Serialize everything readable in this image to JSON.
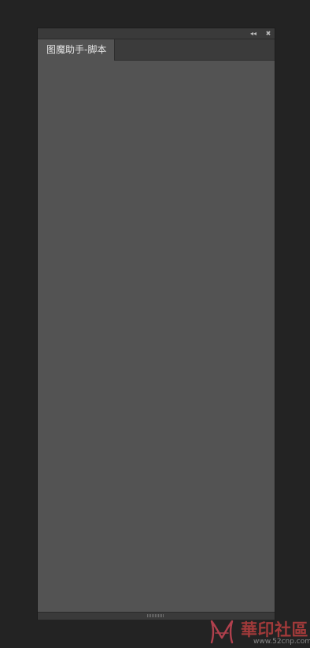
{
  "panel": {
    "collapse_icon": "double-chevron-left",
    "close_icon": "close-x",
    "tabs": [
      {
        "label": "图魔助手-脚本",
        "active": true
      }
    ]
  },
  "watermark": {
    "name": "華印社區",
    "url": "www.52cnp.com"
  },
  "colors": {
    "background": "#232323",
    "panel_content": "#535353",
    "tab_bar": "#3b3b3b",
    "watermark_red": "#a23a3a"
  }
}
